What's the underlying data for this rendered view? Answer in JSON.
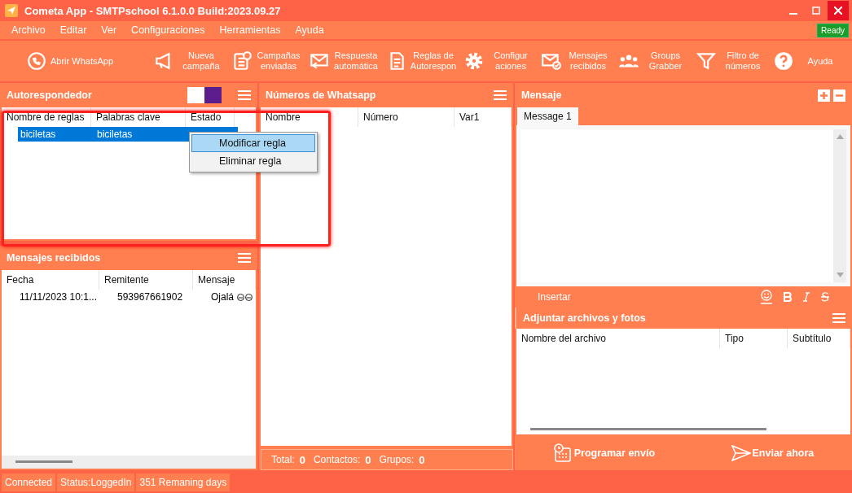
{
  "window": {
    "title": "Cometa App - SMTPschool 6.1.0.0 Build:2023.09.27"
  },
  "menu": [
    "Archivo",
    "Editar",
    "Ver",
    "Configuraciones",
    "Herramientas",
    "Ayuda"
  ],
  "ready_badge": "Ready",
  "toolbar": [
    {
      "kind": "whatsapp",
      "label": "Abrir WhatsApp"
    },
    {
      "kind": "megaphone",
      "label": "Nueva campaña"
    },
    {
      "kind": "list",
      "label": "Campañas enviadas"
    },
    {
      "kind": "reply",
      "label": "Respuesta automática"
    },
    {
      "kind": "doc",
      "label": "Reglas de Autorespon"
    },
    {
      "kind": "gear",
      "label": "Configur aciones"
    },
    {
      "kind": "mail",
      "label": "Mensajes recibidos"
    },
    {
      "kind": "group",
      "label": "Groups Grabber"
    },
    {
      "kind": "filter",
      "label": "Filtro de números"
    },
    {
      "kind": "help",
      "label": "Ayuda"
    }
  ],
  "autoresponder": {
    "title": "Autorespondedor",
    "columns": [
      "Nombre de reglas",
      "Palabras clave",
      "Estado"
    ],
    "rows": [
      {
        "cells": [
          "biciletas",
          "biciletas",
          ""
        ],
        "selected": true
      }
    ],
    "context_menu": [
      {
        "label": "Modificar regla",
        "selected": true
      },
      {
        "label": "Eliminar regla",
        "selected": false
      }
    ]
  },
  "received": {
    "title": "Mensajes recibidos",
    "columns": [
      "Fecha",
      "Remitente",
      "Mensaje"
    ],
    "rows": [
      {
        "cells": [
          "11/11/2023 10:1...",
          "593967661902",
          "Ojalá"
        ]
      }
    ]
  },
  "numbers": {
    "title": "Números de Whatsapp",
    "columns": [
      "Nombre",
      "Número",
      "Var1"
    ],
    "footer": [
      {
        "label": "Total:",
        "value": "0"
      },
      {
        "label": "Contactos:",
        "value": "0"
      },
      {
        "label": "Grupos:",
        "value": "0"
      }
    ]
  },
  "message": {
    "title": "Mensaje",
    "tabs": [
      {
        "label": "Message 1",
        "selected": true
      }
    ],
    "insert_label": "Insertar"
  },
  "attachments": {
    "title": "Adjuntar archivos y fotos",
    "columns": [
      "Nombre del archivo",
      "Tipo",
      "Subtítulo"
    ]
  },
  "actions": [
    {
      "kind": "schedule",
      "label": "Programar envío"
    },
    {
      "kind": "send",
      "label": "Enviar ahora"
    }
  ],
  "status_bar": [
    "Connected",
    "Status:LoggedIn",
    "351 Remaning days"
  ]
}
